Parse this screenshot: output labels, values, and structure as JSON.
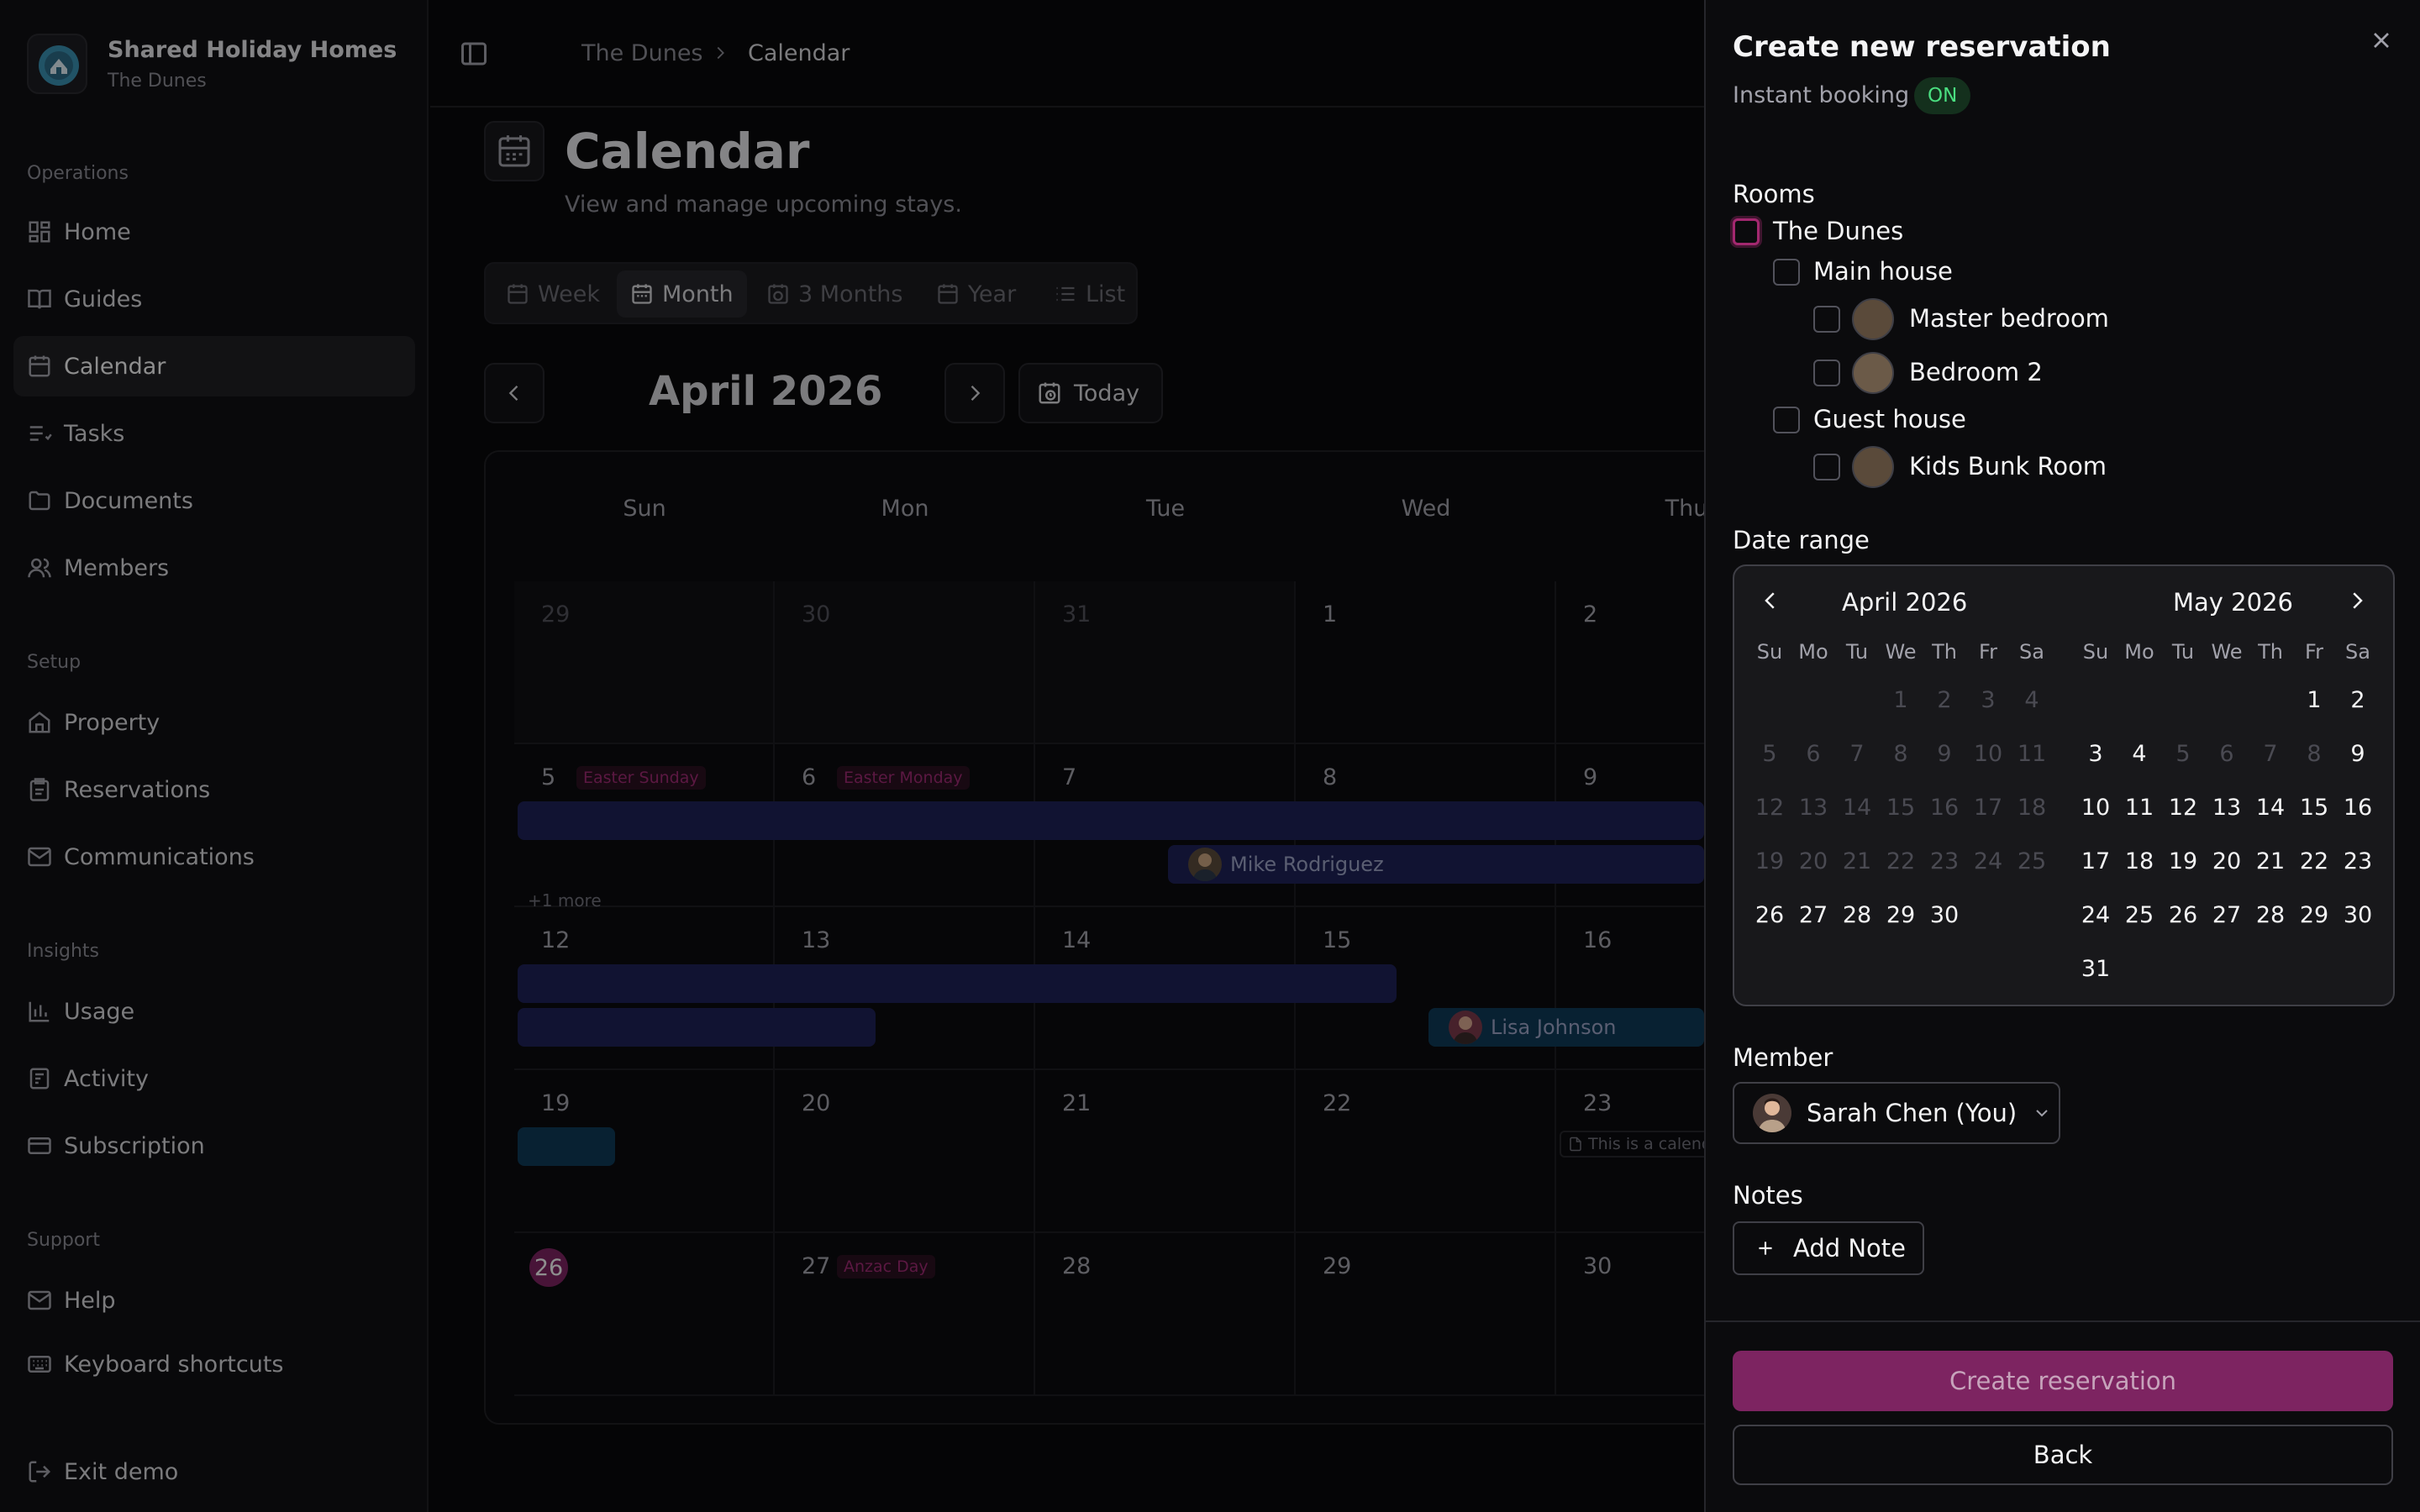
{
  "org": {
    "name": "Shared Holiday Homes",
    "subtitle": "The Dunes"
  },
  "sidebar": {
    "sections": [
      {
        "label": "Operations",
        "items": [
          {
            "label": "Home",
            "icon": "dashboard-icon"
          },
          {
            "label": "Guides",
            "icon": "book-icon"
          },
          {
            "label": "Calendar",
            "icon": "calendar-icon",
            "active": true
          },
          {
            "label": "Tasks",
            "icon": "list-checks-icon"
          },
          {
            "label": "Documents",
            "icon": "folder-icon"
          },
          {
            "label": "Members",
            "icon": "users-icon"
          }
        ]
      },
      {
        "label": "Setup",
        "items": [
          {
            "label": "Property",
            "icon": "home-icon"
          },
          {
            "label": "Reservations",
            "icon": "clipboard-icon"
          },
          {
            "label": "Communications",
            "icon": "mail-icon"
          }
        ]
      },
      {
        "label": "Insights",
        "items": [
          {
            "label": "Usage",
            "icon": "bar-chart-icon"
          },
          {
            "label": "Activity",
            "icon": "activity-icon"
          },
          {
            "label": "Subscription",
            "icon": "credit-card-icon"
          }
        ]
      },
      {
        "label": "Support",
        "items": [
          {
            "label": "Help",
            "icon": "mail-icon"
          },
          {
            "label": "Keyboard shortcuts",
            "icon": "keyboard-icon"
          }
        ]
      }
    ],
    "exit": "Exit demo"
  },
  "breadcrumb": [
    "The Dunes",
    "Calendar"
  ],
  "page": {
    "title": "Calendar",
    "subtitle": "View and manage upcoming stays."
  },
  "view_tabs": [
    "Week",
    "Month",
    "3 Months",
    "Year",
    "List"
  ],
  "calendar": {
    "month_title": "April 2026",
    "today_label": "Today",
    "weekdays": [
      "Sun",
      "Mon",
      "Tue",
      "Wed",
      "Thu"
    ],
    "weeks": [
      [
        {
          "d": "29",
          "out": true
        },
        {
          "d": "30",
          "out": true
        },
        {
          "d": "31",
          "out": true
        },
        {
          "d": "1"
        },
        {
          "d": "2"
        }
      ],
      [
        {
          "d": "5",
          "holiday": "Easter Sunday"
        },
        {
          "d": "6",
          "holiday": "Easter Monday"
        },
        {
          "d": "7"
        },
        {
          "d": "8"
        },
        {
          "d": "9"
        }
      ],
      [
        {
          "d": "12"
        },
        {
          "d": "13"
        },
        {
          "d": "14"
        },
        {
          "d": "15"
        },
        {
          "d": "16"
        }
      ],
      [
        {
          "d": "19"
        },
        {
          "d": "20"
        },
        {
          "d": "21"
        },
        {
          "d": "22"
        },
        {
          "d": "23"
        }
      ],
      [
        {
          "d": "26",
          "today": true
        },
        {
          "d": "27",
          "holiday": "Anzac Day"
        },
        {
          "d": "28"
        },
        {
          "d": "29"
        },
        {
          "d": "30"
        }
      ]
    ],
    "events": {
      "mike": "Mike Rodriguez",
      "lisa": "Lisa Johnson",
      "more": "+1 more",
      "note": "This is a calend"
    }
  },
  "panel": {
    "title": "Create new reservation",
    "instant_label": "Instant booking",
    "instant_badge": "ON",
    "rooms_label": "Rooms",
    "rooms": [
      {
        "label": "The Dunes",
        "level": 0
      },
      {
        "label": "Main house",
        "level": 1
      },
      {
        "label": "Master bedroom",
        "level": 2,
        "photo": true
      },
      {
        "label": "Bedroom 2",
        "level": 2,
        "photo": true
      },
      {
        "label": "Guest house",
        "level": 1
      },
      {
        "label": "Kids Bunk Room",
        "level": 2,
        "photo": true
      }
    ],
    "date_range_label": "Date range",
    "months": [
      {
        "title": "April 2026",
        "weekdays": [
          "Su",
          "Mo",
          "Tu",
          "We",
          "Th",
          "Fr",
          "Sa"
        ],
        "weeks": [
          [
            "",
            "",
            "",
            "1",
            "2",
            "3",
            "4"
          ],
          [
            "5",
            "6",
            "7",
            "8",
            "9",
            "10",
            "11"
          ],
          [
            "12",
            "13",
            "14",
            "15",
            "16",
            "17",
            "18"
          ],
          [
            "19",
            "20",
            "21",
            "22",
            "23",
            "24",
            "25"
          ],
          [
            "26",
            "27",
            "28",
            "29",
            "30",
            "",
            ""
          ]
        ]
      },
      {
        "title": "May 2026",
        "weekdays": [
          "Su",
          "Mo",
          "Tu",
          "We",
          "Th",
          "Fr",
          "Sa"
        ],
        "weeks": [
          [
            "",
            "",
            "",
            "",
            "",
            "1",
            "2"
          ],
          [
            "3",
            "4",
            "5",
            "6",
            "7",
            "8",
            "9"
          ],
          [
            "10",
            "11",
            "12",
            "13",
            "14",
            "15",
            "16"
          ],
          [
            "17",
            "18",
            "19",
            "20",
            "21",
            "22",
            "23"
          ],
          [
            "24",
            "25",
            "26",
            "27",
            "28",
            "29",
            "30"
          ],
          [
            "31",
            "",
            "",
            "",
            "",
            "",
            ""
          ]
        ]
      }
    ],
    "member_label": "Member",
    "member_value": "Sarah Chen (You)",
    "notes_label": "Notes",
    "add_note": "Add Note",
    "create_btn": "Create reservation",
    "back_btn": "Back"
  },
  "colors": {
    "accent": "#7d2461",
    "event": "#1e2257",
    "event_teal": "#0e3a57",
    "badge_bg": "#14301d",
    "badge_fg": "#4ade80"
  }
}
